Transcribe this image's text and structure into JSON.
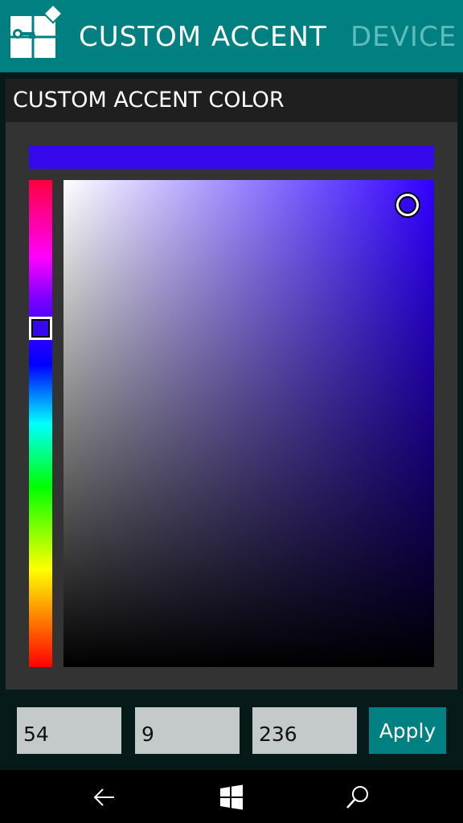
{
  "header": {
    "active_tab": "CUSTOM ACCENT",
    "inactive_tab": "DEVICE",
    "logo_icon": "app-logo-icon"
  },
  "panel": {
    "title": "CUSTOM ACCENT COLOR"
  },
  "color": {
    "r": "54",
    "g": "9",
    "b": "236",
    "hex": "#3609ec",
    "hue_hex": "#3000ff"
  },
  "actions": {
    "apply_label": "Apply"
  },
  "navbar": {
    "icons": [
      "back-icon",
      "windows-start-icon",
      "search-icon"
    ]
  }
}
